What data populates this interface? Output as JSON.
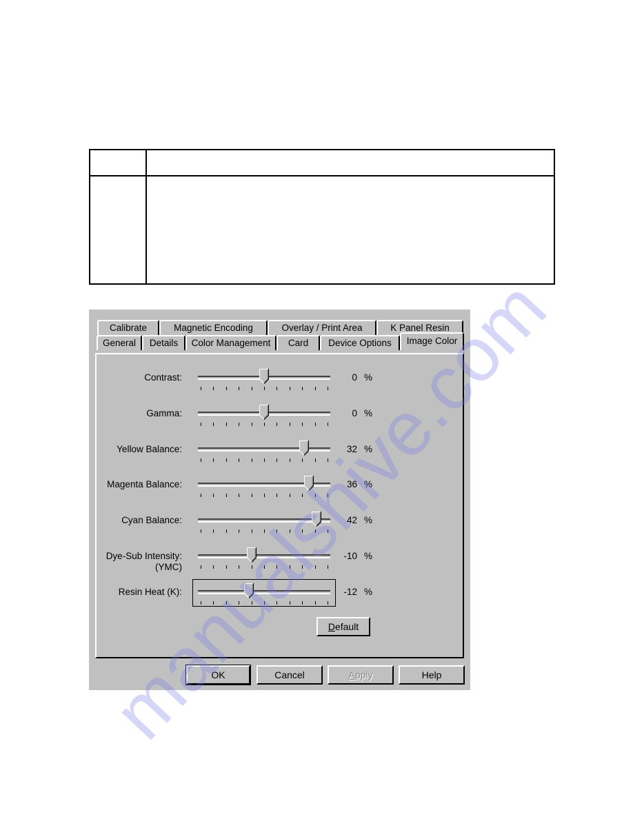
{
  "document": {
    "table": {
      "rows": 2,
      "columns": 2,
      "cells": [
        [
          "",
          ""
        ],
        [
          "",
          ""
        ]
      ]
    }
  },
  "dialog": {
    "tabs_row_back": [
      {
        "label": "Calibrate"
      },
      {
        "label": "Magnetic Encoding"
      },
      {
        "label": "Overlay / Print Area"
      },
      {
        "label": "K Panel Resin"
      }
    ],
    "tabs_row_front": [
      {
        "label": "General"
      },
      {
        "label": "Details"
      },
      {
        "label": "Color Management"
      },
      {
        "label": "Card"
      },
      {
        "label": "Device Options"
      },
      {
        "label": "Image Color",
        "active": true
      }
    ],
    "slider_range": [
      -50,
      50
    ],
    "sliders": [
      {
        "label": "Contrast:",
        "value": 0,
        "display": "0",
        "unit": "%"
      },
      {
        "label": "Gamma:",
        "value": 0,
        "display": "0",
        "unit": "%"
      },
      {
        "label": "Yellow Balance:",
        "value": 32,
        "display": "32",
        "unit": "%"
      },
      {
        "label": "Magenta Balance:",
        "value": 36,
        "display": "36",
        "unit": "%"
      },
      {
        "label": "Cyan Balance:",
        "value": 42,
        "display": "42",
        "unit": "%"
      },
      {
        "label": "Dye-Sub Intensity:",
        "label_line2": "(YMC)",
        "value": -10,
        "display": "-10",
        "unit": "%"
      },
      {
        "label": "Resin Heat  (K):",
        "value": -12,
        "display": "-12",
        "unit": "%",
        "focused": true
      }
    ],
    "default_button": {
      "label_mnemonic": "D",
      "label_rest": "efault"
    },
    "buttons": {
      "ok": "OK",
      "cancel": "Cancel",
      "apply_mnemonic": "A",
      "apply_rest": "pply",
      "help": "Help"
    }
  },
  "watermark": "manualshive.com"
}
